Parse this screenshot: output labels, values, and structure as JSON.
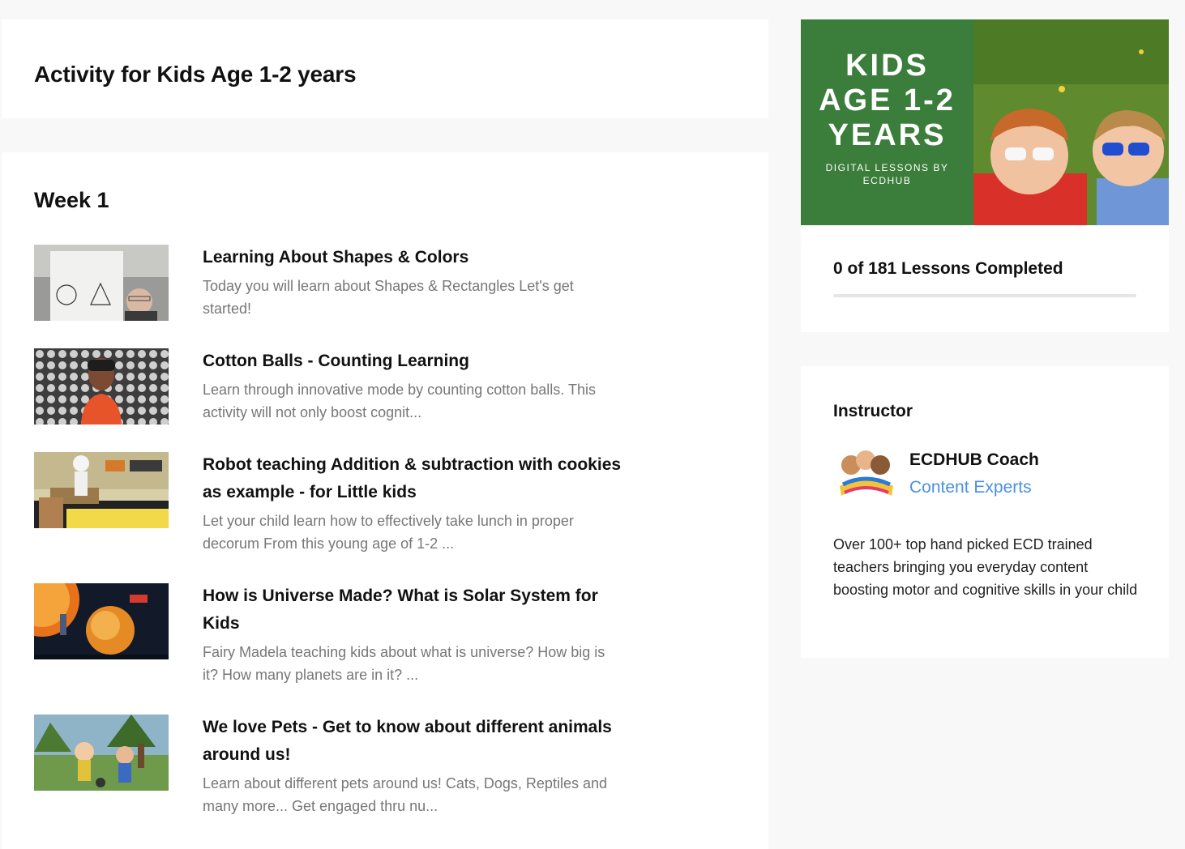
{
  "course": {
    "title": "Activity for Kids Age 1-2 years"
  },
  "section": {
    "title": "Week 1"
  },
  "lessons": [
    {
      "title": "Learning About Shapes & Colors",
      "desc": "Today you will learn about Shapes & Rectangles  Let's get started!"
    },
    {
      "title": "Cotton Balls - Counting Learning",
      "desc": "Learn through innovative mode by counting cotton balls. This activity will not only boost cognit..."
    },
    {
      "title": "Robot teaching Addition & subtraction with cookies as example - for Little kids",
      "desc": "Let your child learn how to effectively take lunch in proper decorum From this young age of 1-2 ..."
    },
    {
      "title": "How is Universe Made? What is Solar System for Kids",
      "desc": "Fairy Madela teaching kids about what is universe? How big is it? How many planets are in it? ..."
    },
    {
      "title": "We love Pets - Get to know about different animals around us!",
      "desc": "Learn about different pets around us! Cats, Dogs, Reptiles and many more... Get engaged thru nu..."
    }
  ],
  "hero": {
    "line1": "KIDS",
    "line2": "AGE 1-2",
    "line3": "YEARS",
    "sub1": "DIGITAL LESSONS BY",
    "sub2": "ECDHUB",
    "green": "#3b7d3a"
  },
  "progress": {
    "label": "0 of 181 Lessons Completed",
    "completed": 0,
    "total": 181
  },
  "instructor": {
    "heading": "Instructor",
    "name": "ECDHUB Coach",
    "role": "Content Experts",
    "bio": "Over 100+ top hand picked ECD trained teachers bringing you everyday content boosting motor and cognitive skills in your child"
  },
  "colors": {
    "accent": "#4a90e2",
    "background": "#f8f8f8",
    "card": "#ffffff"
  }
}
